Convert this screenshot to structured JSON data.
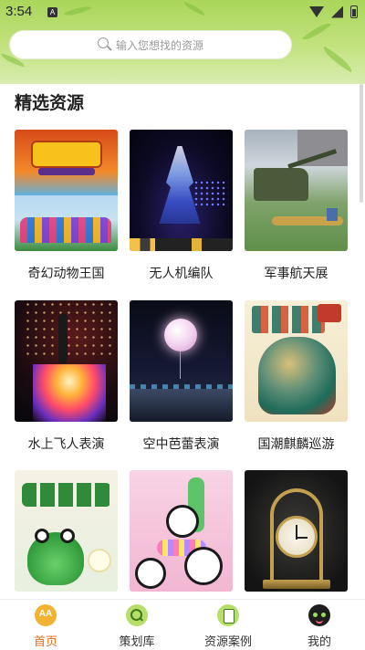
{
  "status_bar": {
    "time": "3:54",
    "notification_badge": "A"
  },
  "search": {
    "placeholder": "输入您想找的资源"
  },
  "section": {
    "title": "精选资源"
  },
  "resources": [
    {
      "label": "奇幻动物王国"
    },
    {
      "label": "无人机编队"
    },
    {
      "label": "军事航天展"
    },
    {
      "label": "水上飞人表演"
    },
    {
      "label": "空中芭蕾表演"
    },
    {
      "label": "国潮麒麟巡游"
    },
    {
      "label": ""
    },
    {
      "label": ""
    },
    {
      "label": ""
    }
  ],
  "bottom_nav": {
    "items": [
      {
        "label": "首页",
        "icon": "home-icon",
        "active": true
      },
      {
        "label": "策划库",
        "icon": "planning-library-icon",
        "active": false
      },
      {
        "label": "资源案例",
        "icon": "resource-cases-icon",
        "active": false
      },
      {
        "label": "我的",
        "icon": "profile-icon",
        "active": false
      }
    ],
    "active_color": "#e66a18"
  },
  "colors": {
    "header_green": "#a9d65a",
    "accent": "#e66a18"
  }
}
